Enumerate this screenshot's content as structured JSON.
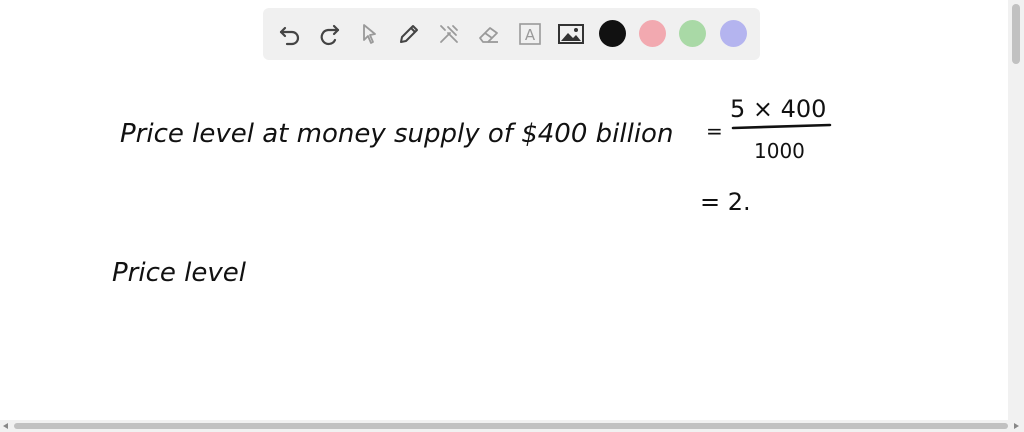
{
  "toolbar": {
    "tools": [
      {
        "icon": "undo-icon"
      },
      {
        "icon": "redo-icon"
      },
      {
        "icon": "pointer-icon"
      },
      {
        "icon": "pen-icon"
      },
      {
        "icon": "tools-icon"
      },
      {
        "icon": "eraser-icon"
      },
      {
        "icon": "text-icon",
        "glyph": "A"
      },
      {
        "icon": "image-icon"
      }
    ],
    "colors": [
      "#111111",
      "#f2a9b0",
      "#a9d9a6",
      "#b4b4ef"
    ]
  },
  "whiteboard": {
    "line1_text": "Price level at money supply of $400 billion",
    "equals": "=",
    "numerator": "5 × 400",
    "denominator": "1000",
    "result": "= 2.",
    "line2_text": "Price level"
  }
}
